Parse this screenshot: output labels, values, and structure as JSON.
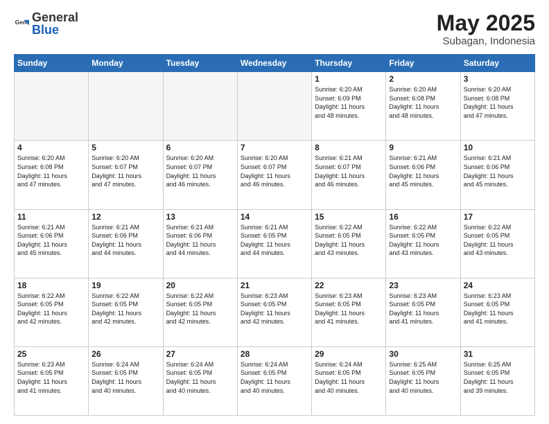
{
  "header": {
    "logo_general": "General",
    "logo_blue": "Blue",
    "month_year": "May 2025",
    "location": "Subagan, Indonesia"
  },
  "weekdays": [
    "Sunday",
    "Monday",
    "Tuesday",
    "Wednesday",
    "Thursday",
    "Friday",
    "Saturday"
  ],
  "weeks": [
    [
      {
        "day": "",
        "info": ""
      },
      {
        "day": "",
        "info": ""
      },
      {
        "day": "",
        "info": ""
      },
      {
        "day": "",
        "info": ""
      },
      {
        "day": "1",
        "info": "Sunrise: 6:20 AM\nSunset: 6:09 PM\nDaylight: 11 hours\nand 48 minutes."
      },
      {
        "day": "2",
        "info": "Sunrise: 6:20 AM\nSunset: 6:08 PM\nDaylight: 11 hours\nand 48 minutes."
      },
      {
        "day": "3",
        "info": "Sunrise: 6:20 AM\nSunset: 6:08 PM\nDaylight: 11 hours\nand 47 minutes."
      }
    ],
    [
      {
        "day": "4",
        "info": "Sunrise: 6:20 AM\nSunset: 6:08 PM\nDaylight: 11 hours\nand 47 minutes."
      },
      {
        "day": "5",
        "info": "Sunrise: 6:20 AM\nSunset: 6:07 PM\nDaylight: 11 hours\nand 47 minutes."
      },
      {
        "day": "6",
        "info": "Sunrise: 6:20 AM\nSunset: 6:07 PM\nDaylight: 11 hours\nand 46 minutes."
      },
      {
        "day": "7",
        "info": "Sunrise: 6:20 AM\nSunset: 6:07 PM\nDaylight: 11 hours\nand 46 minutes."
      },
      {
        "day": "8",
        "info": "Sunrise: 6:21 AM\nSunset: 6:07 PM\nDaylight: 11 hours\nand 46 minutes."
      },
      {
        "day": "9",
        "info": "Sunrise: 6:21 AM\nSunset: 6:06 PM\nDaylight: 11 hours\nand 45 minutes."
      },
      {
        "day": "10",
        "info": "Sunrise: 6:21 AM\nSunset: 6:06 PM\nDaylight: 11 hours\nand 45 minutes."
      }
    ],
    [
      {
        "day": "11",
        "info": "Sunrise: 6:21 AM\nSunset: 6:06 PM\nDaylight: 11 hours\nand 45 minutes."
      },
      {
        "day": "12",
        "info": "Sunrise: 6:21 AM\nSunset: 6:06 PM\nDaylight: 11 hours\nand 44 minutes."
      },
      {
        "day": "13",
        "info": "Sunrise: 6:21 AM\nSunset: 6:06 PM\nDaylight: 11 hours\nand 44 minutes."
      },
      {
        "day": "14",
        "info": "Sunrise: 6:21 AM\nSunset: 6:05 PM\nDaylight: 11 hours\nand 44 minutes."
      },
      {
        "day": "15",
        "info": "Sunrise: 6:22 AM\nSunset: 6:05 PM\nDaylight: 11 hours\nand 43 minutes."
      },
      {
        "day": "16",
        "info": "Sunrise: 6:22 AM\nSunset: 6:05 PM\nDaylight: 11 hours\nand 43 minutes."
      },
      {
        "day": "17",
        "info": "Sunrise: 6:22 AM\nSunset: 6:05 PM\nDaylight: 11 hours\nand 43 minutes."
      }
    ],
    [
      {
        "day": "18",
        "info": "Sunrise: 6:22 AM\nSunset: 6:05 PM\nDaylight: 11 hours\nand 42 minutes."
      },
      {
        "day": "19",
        "info": "Sunrise: 6:22 AM\nSunset: 6:05 PM\nDaylight: 11 hours\nand 42 minutes."
      },
      {
        "day": "20",
        "info": "Sunrise: 6:22 AM\nSunset: 6:05 PM\nDaylight: 11 hours\nand 42 minutes."
      },
      {
        "day": "21",
        "info": "Sunrise: 6:23 AM\nSunset: 6:05 PM\nDaylight: 11 hours\nand 42 minutes."
      },
      {
        "day": "22",
        "info": "Sunrise: 6:23 AM\nSunset: 6:05 PM\nDaylight: 11 hours\nand 41 minutes."
      },
      {
        "day": "23",
        "info": "Sunrise: 6:23 AM\nSunset: 6:05 PM\nDaylight: 11 hours\nand 41 minutes."
      },
      {
        "day": "24",
        "info": "Sunrise: 6:23 AM\nSunset: 6:05 PM\nDaylight: 11 hours\nand 41 minutes."
      }
    ],
    [
      {
        "day": "25",
        "info": "Sunrise: 6:23 AM\nSunset: 6:05 PM\nDaylight: 11 hours\nand 41 minutes."
      },
      {
        "day": "26",
        "info": "Sunrise: 6:24 AM\nSunset: 6:05 PM\nDaylight: 11 hours\nand 40 minutes."
      },
      {
        "day": "27",
        "info": "Sunrise: 6:24 AM\nSunset: 6:05 PM\nDaylight: 11 hours\nand 40 minutes."
      },
      {
        "day": "28",
        "info": "Sunrise: 6:24 AM\nSunset: 6:05 PM\nDaylight: 11 hours\nand 40 minutes."
      },
      {
        "day": "29",
        "info": "Sunrise: 6:24 AM\nSunset: 6:05 PM\nDaylight: 11 hours\nand 40 minutes."
      },
      {
        "day": "30",
        "info": "Sunrise: 6:25 AM\nSunset: 6:05 PM\nDaylight: 11 hours\nand 40 minutes."
      },
      {
        "day": "31",
        "info": "Sunrise: 6:25 AM\nSunset: 6:05 PM\nDaylight: 11 hours\nand 39 minutes."
      }
    ]
  ]
}
